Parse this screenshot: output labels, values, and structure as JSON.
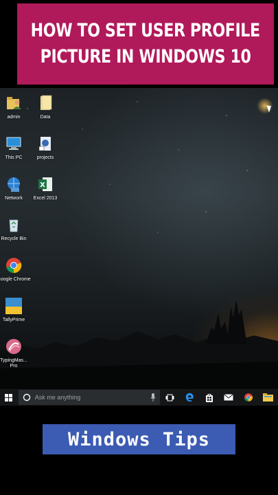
{
  "banner": {
    "line1": "HOW TO SET USER PROFILE",
    "line2": "PICTURE IN WINDOWS 10",
    "bg_color": "#b0195a"
  },
  "desktop": {
    "icons": [
      {
        "label": "admin",
        "icon": "user-folder-icon"
      },
      {
        "label": "Data",
        "icon": "folder-icon"
      },
      {
        "label": "This PC",
        "icon": "computer-icon"
      },
      {
        "label": "projects",
        "icon": "document-file-icon"
      },
      {
        "label": "Network",
        "icon": "network-icon"
      },
      {
        "label": "Excel 2013",
        "icon": "excel-icon"
      },
      {
        "label": "Recycle Bin",
        "icon": "recycle-bin-icon"
      },
      {
        "label": "Google Chrome",
        "icon": "chrome-icon"
      },
      {
        "label": "TallyPrime",
        "icon": "tallyprime-icon"
      },
      {
        "label": "TypingMas... Pro",
        "icon": "typingmaster-icon"
      }
    ]
  },
  "taskbar": {
    "search_placeholder": "Ask me anything",
    "items": [
      "start-icon",
      "search-icon",
      "microphone-icon",
      "task-view-icon",
      "edge-icon",
      "store-icon",
      "mail-icon",
      "chrome-icon",
      "file-explorer-icon"
    ]
  },
  "footer": {
    "label": "Windows Tips",
    "bg_color": "#3c5bb3"
  }
}
